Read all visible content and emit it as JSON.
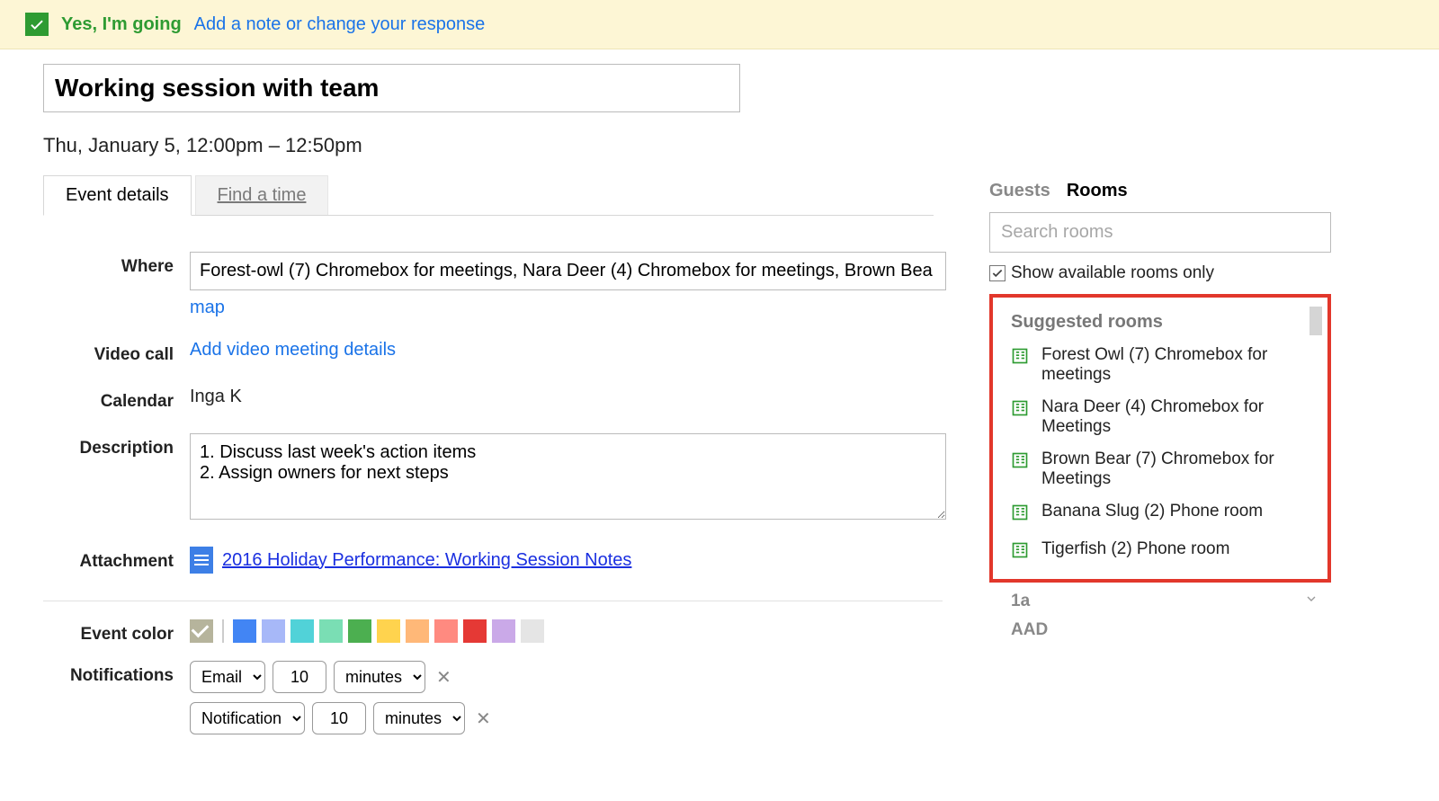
{
  "rsvp": {
    "status": "Yes, I'm going",
    "change_link": "Add a note or change your response"
  },
  "event": {
    "title": "Working session with team",
    "datetime": "Thu, January 5, 12:00pm – 12:50pm"
  },
  "tabs": {
    "details": "Event details",
    "find_time": "Find a time"
  },
  "labels": {
    "where": "Where",
    "video_call": "Video call",
    "calendar": "Calendar",
    "description": "Description",
    "attachment": "Attachment",
    "event_color": "Event color",
    "notifications": "Notifications"
  },
  "where": {
    "value": "Forest-owl (7) Chromebox for meetings, Nara Deer (4) Chromebox for meetings, Brown Bea",
    "map_link": "map"
  },
  "video_call": {
    "link": "Add video meeting details"
  },
  "calendar": "Inga K",
  "description": "1. Discuss last week's action items\n2. Assign owners for next steps",
  "attachment": {
    "name": "2016 Holiday Performance: Working Session Notes"
  },
  "colors": {
    "checked": "#b6b49c",
    "palette": [
      "#4285f4",
      "#a7b8f8",
      "#51d2d8",
      "#7adeb4",
      "#4caf50",
      "#ffd34e",
      "#ffb878",
      "#ff8a80",
      "#e53935",
      "#caa9e8",
      "#e5e5e5"
    ]
  },
  "notifications": [
    {
      "method": "Email",
      "value": "10",
      "unit": "minutes"
    },
    {
      "method": "Notification",
      "value": "10",
      "unit": "minutes"
    }
  ],
  "right": {
    "tabs": {
      "guests": "Guests",
      "rooms": "Rooms"
    },
    "search_placeholder": "Search rooms",
    "show_available": "Show available rooms only",
    "suggested_heading": "Suggested rooms",
    "suggested": [
      "Forest Owl (7) Chromebox for meetings",
      "Nara Deer (4) Chromebox for Meetings",
      "Brown Bear (7) Chromebox for Meetings",
      "Banana Slug (2) Phone room",
      "Tigerfish (2) Phone room"
    ],
    "floors": {
      "f1": "1a",
      "f2": "AAD"
    }
  }
}
